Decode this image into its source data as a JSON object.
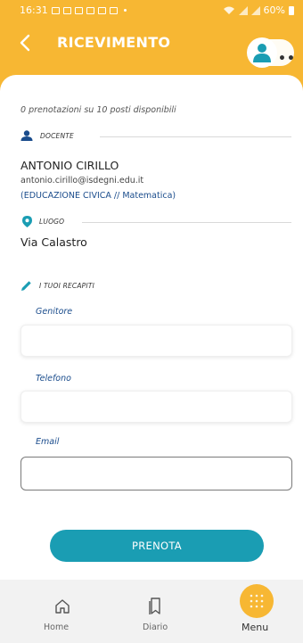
{
  "status_bar": {
    "time": "16:31",
    "battery": "60%"
  },
  "header": {
    "title": "RICEVIMENTO"
  },
  "availability_text": "0 prenotazioni su 10 posti disponibili",
  "teacher_section": {
    "heading": "DOCENTE",
    "name": "ANTONIO CIRILLO",
    "email": "antonio.cirillo@isdegni.edu.it",
    "subjects": "(EDUCAZIONE CIVICA // Matematica)"
  },
  "place_section": {
    "heading": "LUOGO",
    "place": "Via Calastro"
  },
  "contacts_section": {
    "heading": "I TUOI RECAPITI",
    "fields": [
      {
        "label": "Genitore",
        "value": ""
      },
      {
        "label": "Telefono",
        "value": ""
      },
      {
        "label": "Email",
        "value": ""
      }
    ]
  },
  "book_button": "PRENOTA",
  "bottom_nav": {
    "items": [
      {
        "label": "Home",
        "icon": "home-icon"
      },
      {
        "label": "Diario",
        "icon": "bookmark-icon"
      },
      {
        "label": "Menu",
        "icon": "grid-dots-icon"
      }
    ]
  },
  "colors": {
    "accent": "#f7b733",
    "button": "#1a9db3",
    "link": "#1a4c8c"
  }
}
